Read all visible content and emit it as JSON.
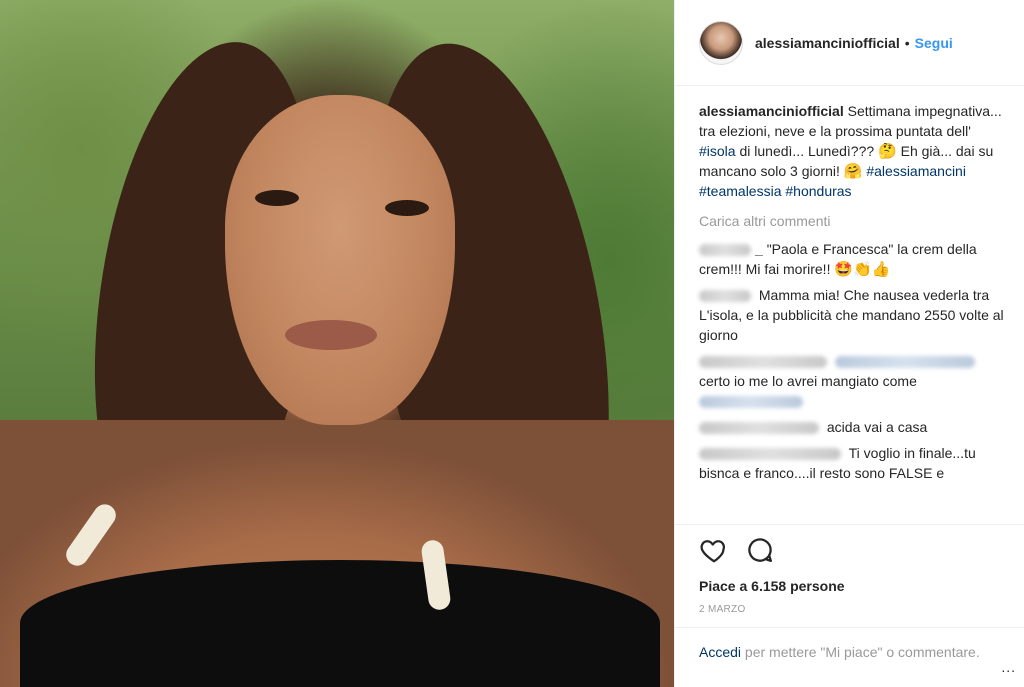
{
  "header": {
    "username": "alessiamanciniofficial",
    "separator": "•",
    "follow_label": "Segui"
  },
  "caption": {
    "author": "alessiamanciniofficial",
    "text_1": "Settimana impegnativa... tra elezioni, neve e la prossima puntata dell'",
    "tag_isola": "#isola",
    "text_2": "di lunedì... Lunedì???",
    "emoji_1": "🤔",
    "text_3": "Eh già... dai su mancano solo 3 giorni!",
    "emoji_2": "🤗",
    "tag_1": "#alessiamancini",
    "tag_2": "#teamalessia",
    "tag_3": "#honduras"
  },
  "load_more_label": "Carica altri commenti",
  "comments": [
    {
      "author": "_",
      "text": "\"Paola e Francesca\" la crem della crem!!! Mi fai morire!!",
      "emoji": "🤩👏👍"
    },
    {
      "text": "Mamma mia! Che nausea vederla tra L'isola, e la pubblicità che mandano 2550 volte al giorno"
    },
    {
      "text": "certo io me lo avrei mangiato come"
    },
    {
      "text": "acida vai a casa"
    },
    {
      "text": "Ti voglio in finale...tu bisnca e franco....il resto sono FALSE e"
    }
  ],
  "actions": {
    "like_icon": "heart-icon",
    "comment_icon": "comment-icon"
  },
  "likes_label": "Piace a 6.158 persone",
  "date_label": "2 MARZO",
  "login": {
    "link": "Accedi",
    "text": "per mettere \"Mi piace\" o commentare."
  },
  "more_label": "..."
}
